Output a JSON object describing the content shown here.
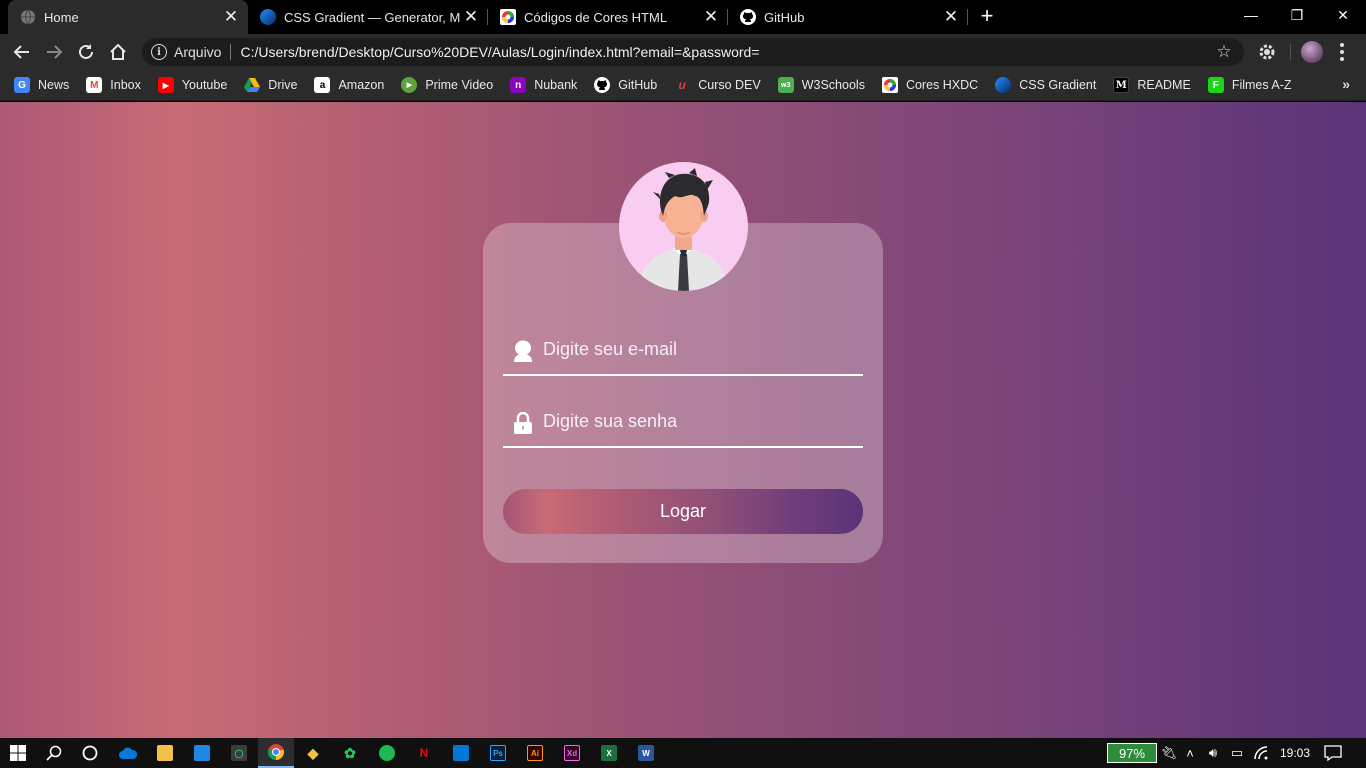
{
  "browser": {
    "tabs": [
      {
        "title": "Home",
        "icon": "globe-icon",
        "active": true
      },
      {
        "title": "CSS Gradient — Generator, Maker",
        "icon": "css-gradient-icon",
        "active": false
      },
      {
        "title": "Códigos de Cores HTML",
        "icon": "color-codes-icon",
        "active": false
      },
      {
        "title": "GitHub",
        "icon": "github-icon",
        "active": false
      }
    ],
    "new_tab": "+",
    "window_controls": {
      "minimize": "—",
      "restore": "❐",
      "close": "✕"
    },
    "address_bar": {
      "scheme_label": "Arquivo",
      "url": "C:/Users/brend/Desktop/Curso%20DEV/Aulas/Login/index.html?email=&password="
    },
    "bookmarks": [
      {
        "label": "News",
        "icon": "google-news-icon",
        "color": "#4285f4"
      },
      {
        "label": "Inbox",
        "icon": "gmail-icon",
        "color": "#ea4335"
      },
      {
        "label": "Youtube",
        "icon": "youtube-icon",
        "color": "#ff0000"
      },
      {
        "label": "Drive",
        "icon": "drive-icon",
        "color": "#fbbc04"
      },
      {
        "label": "Amazon",
        "icon": "amazon-icon",
        "color": "#ffffff"
      },
      {
        "label": "Prime Video",
        "icon": "prime-video-icon",
        "color": "#5ba43a"
      },
      {
        "label": "Nubank",
        "icon": "nubank-icon",
        "color": "#8a05be"
      },
      {
        "label": "GitHub",
        "icon": "github-icon",
        "color": "#ffffff"
      },
      {
        "label": "Curso DEV",
        "icon": "curso-dev-icon",
        "color": "#e0413f"
      },
      {
        "label": "W3Schools",
        "icon": "w3schools-icon",
        "color": "#4caf50"
      },
      {
        "label": "Cores HXDC",
        "icon": "color-wheel-icon",
        "color": "#ffffff"
      },
      {
        "label": "CSS Gradient",
        "icon": "css-gradient-icon",
        "color": "#1e6fd9"
      },
      {
        "label": "README",
        "icon": "medium-icon",
        "color": "#000000"
      },
      {
        "label": "Filmes A-Z",
        "icon": "filmes-icon",
        "color": "#1bd51b"
      }
    ],
    "bookmarks_overflow": "»"
  },
  "login": {
    "email_placeholder": "Digite seu e-mail",
    "password_placeholder": "Digite sua senha",
    "button_label": "Logar"
  },
  "taskbar": {
    "battery": "97%",
    "clock": "19:03"
  },
  "colors": {
    "gradient_start": "#c76b75",
    "gradient_end": "#5a3378",
    "avatar_bg": "#f9ccf2"
  }
}
